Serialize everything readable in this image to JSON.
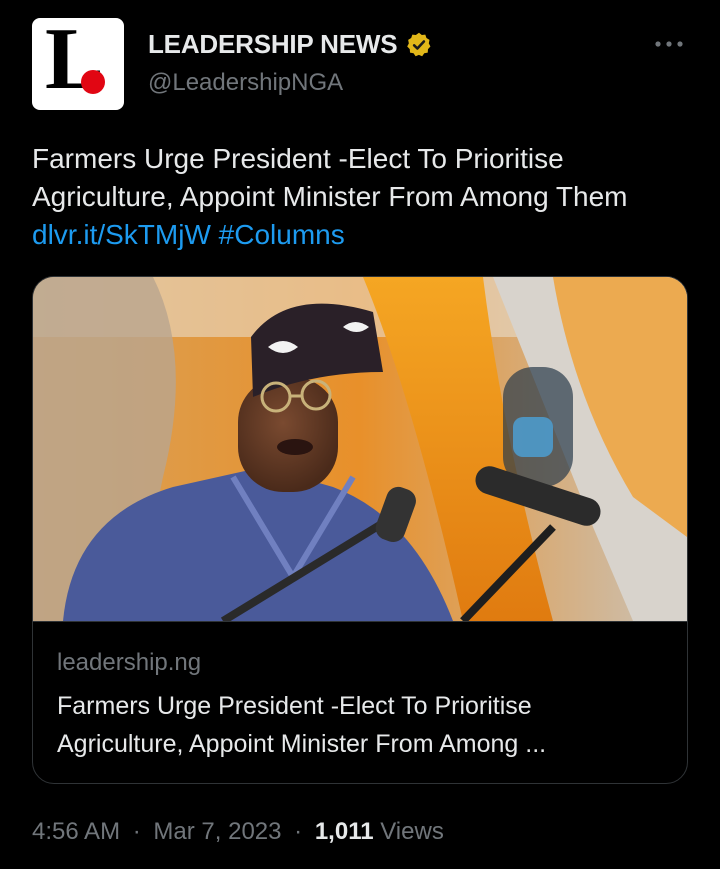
{
  "author": {
    "display_name": "LEADERSHIP NEWS",
    "handle": "@LeadershipNGA",
    "verified_badge": "gold-verified-icon",
    "avatar_letter": "L"
  },
  "tweet": {
    "text": "Farmers Urge President -Elect To Prioritise Agriculture, Appoint Minister From Among Them",
    "link_text": "dlvr.it/SkTMjW",
    "hashtag": "#Columns"
  },
  "card": {
    "domain": "leadership.ng",
    "title": "Farmers Urge President -Elect To Prioritise Agriculture, Appoint Minister From Among ..."
  },
  "meta": {
    "time": "4:56 AM",
    "separator": "·",
    "date": "Mar 7, 2023",
    "views_count": "1,011",
    "views_label": "Views"
  },
  "colors": {
    "background": "#000000",
    "text": "#e7e9ea",
    "secondary": "#71767b",
    "link": "#1d9bf0",
    "verified": "#e2b719",
    "border": "#2f3336"
  }
}
